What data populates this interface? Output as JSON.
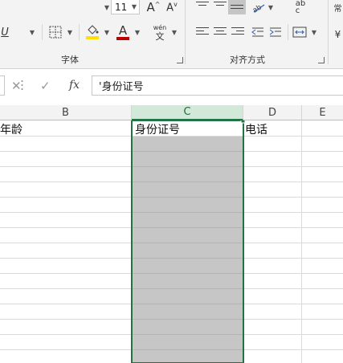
{
  "ribbon": {
    "font_size": "11",
    "grow_font_icon": "A^",
    "shrink_font_icon": "Av",
    "underline_icon": "U",
    "font_color_icon": "A",
    "phonetic_top": "wén",
    "phonetic_bottom": "文",
    "wrap_icon": "ab\nc",
    "font_group_label": "字体",
    "align_group_label": "对齐方式",
    "colors": {
      "highlight": "#ffe100",
      "font_color": "#c00000"
    }
  },
  "formula_bar": {
    "cancel_icon": "✕",
    "enter_icon": "✓",
    "fx_label": "fx",
    "content": "'身份证号"
  },
  "columns": [
    "B",
    "C",
    "D",
    "E"
  ],
  "selected_column": "C",
  "cells": {
    "b1": "年龄",
    "c1": "身份证号",
    "d1": "电话"
  },
  "colors": {
    "accent": "#217346",
    "selection_fill": "#c6c6c6",
    "header_selected": "#d2e8d9"
  }
}
